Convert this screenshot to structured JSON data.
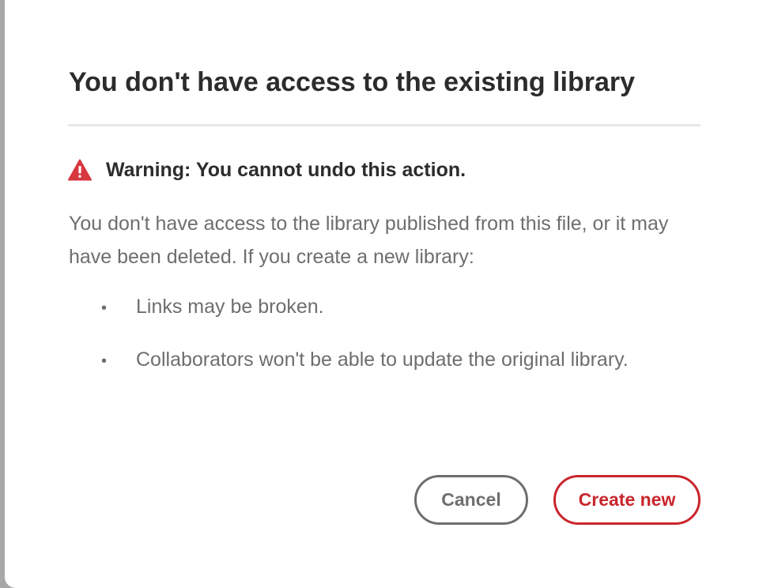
{
  "dialog": {
    "title": "You don't have access to the existing library",
    "warning": {
      "icon": "warning-triangle-icon",
      "icon_color": "#d7373f",
      "text": "Warning: You cannot undo this action."
    },
    "body": "You don't have access to the library published from this file, or it may have been deleted. If you create a new library:",
    "bullets": [
      {
        "marker": "•",
        "text": "Links may be broken."
      },
      {
        "marker": "•",
        "text": "Collaborators won't be able to update the original library."
      }
    ],
    "buttons": {
      "cancel_label": "Cancel",
      "create_label": "Create new"
    },
    "colors": {
      "accent": "#c9252c",
      "text_primary": "#2c2c2c",
      "text_secondary": "#6e6e6e"
    }
  }
}
